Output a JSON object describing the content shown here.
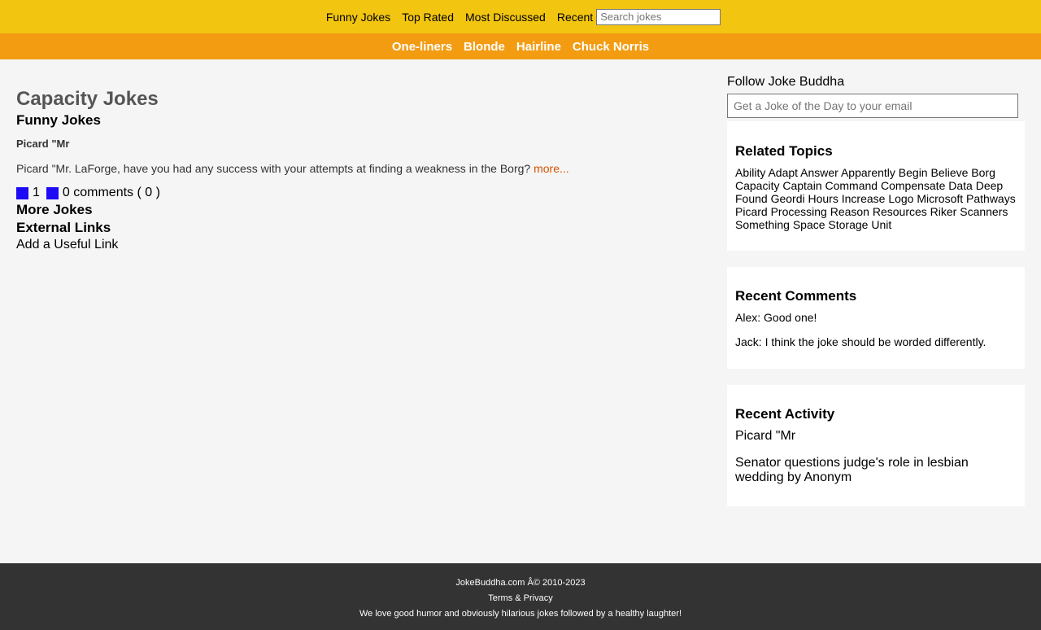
{
  "topnav": {
    "links": [
      "Funny Jokes",
      "Top Rated",
      "Most Discussed",
      "Recent"
    ],
    "search_placeholder": "Search jokes"
  },
  "catnav": {
    "links": [
      "One-liners",
      "Blonde",
      "Hairline",
      "Chuck Norris"
    ]
  },
  "main": {
    "page_title": "Capacity Jokes",
    "section_funny": "Funny Jokes",
    "joke": {
      "title": "Picard \"Mr",
      "text": "Picard \"Mr. LaForge, have you had any success with your attempts at finding a weakness in the Borg?",
      "more_label": "more...",
      "votes_up": "1",
      "comments": "0 comments ( 0 )"
    },
    "section_more": "More Jokes",
    "section_external": "External Links",
    "add_link": "Add a Useful Link"
  },
  "sidebar": {
    "follow_label": "Follow Joke Buddha",
    "email_placeholder": "Get a Joke of the Day to your email",
    "related_title": "Related Topics",
    "related_topics": "Ability Adapt Answer Apparently Begin Believe Borg Capacity Captain Command Compensate Data Deep Found Geordi Hours Increase Logo Microsoft Pathways Picard Processing Reason Resources Riker Scanners Something Space Storage Unit",
    "comments_title": "Recent Comments",
    "comments": [
      "Alex: Good one!",
      "Jack: I think the joke should be worded differently."
    ],
    "activity_title": "Recent Activity",
    "activity": [
      "Picard \"Mr",
      "Senator questions judge's role in lesbian wedding by Anonym"
    ]
  },
  "footer": {
    "copyright": "JokeBuddha.com Â© 2010-2023",
    "terms": "Terms & Privacy",
    "tagline": "We love good humor and obviously hilarious jokes followed by a healthy laughter!"
  },
  "colors": {
    "topnav_bg": "#f2c511",
    "catnav_bg": "#f39c12",
    "link_accent": "#d35400",
    "vote_square": "#1d0bf5",
    "footer_bg": "#333333"
  }
}
